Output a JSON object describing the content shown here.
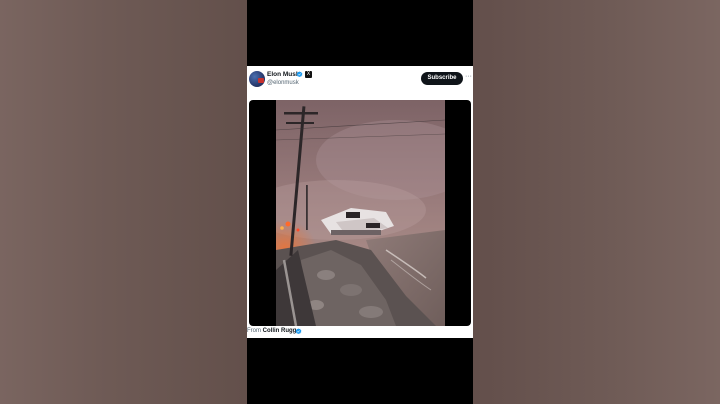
{
  "tweet": {
    "author_name": "Elon Musk",
    "author_handle": "@elonmusk",
    "affiliate_badge": "X",
    "subscribe_label": "Subscribe",
    "more_label": "···",
    "from_prefix": "From",
    "from_name": "Collin Rugg"
  },
  "icons": {
    "verified": "verified-badge-icon",
    "more": "more-options-icon"
  },
  "colors": {
    "verified_blue": "#1d9bf0",
    "subscribe_bg": "#0f1419",
    "handle_gray": "#536471",
    "smoke": "#8a6f70",
    "fire": "#e05a2a"
  }
}
